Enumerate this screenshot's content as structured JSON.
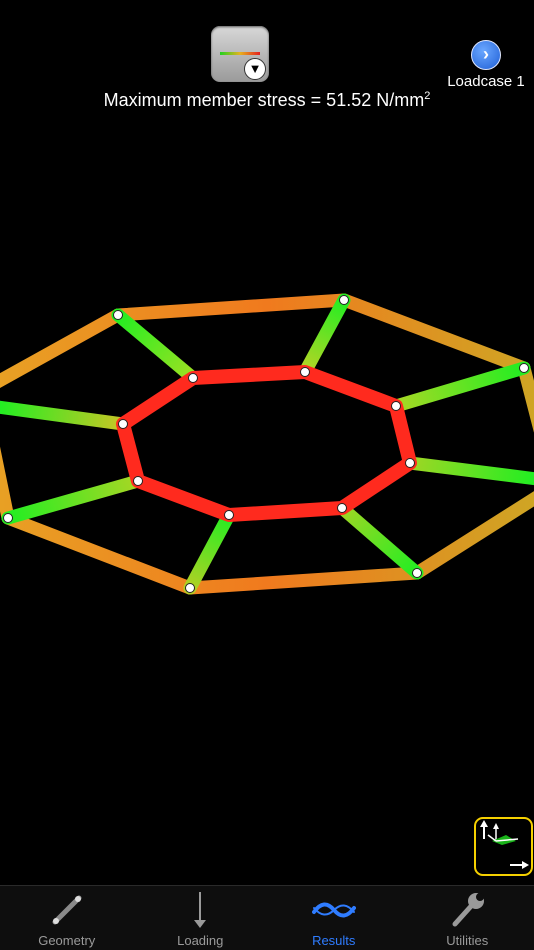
{
  "header": {
    "loadcase_label": "Loadcase 1",
    "stress_prefix": "Maximum member stress = 51.52 N/mm",
    "stress_exponent": "2"
  },
  "colors": {
    "high_stress": "#ff2a1e",
    "mid_stress": "#ee8a1f",
    "low_stress": "#21e621",
    "tab_active": "#2f7cff",
    "tab_inactive": "#9a9a9a",
    "axes_border": "#f5d000"
  },
  "tabs": [
    {
      "label": "Geometry",
      "icon": "geometry-icon"
    },
    {
      "label": "Loading",
      "icon": "loading-arrow-icon"
    },
    {
      "label": "Results",
      "icon": "results-wave-icon",
      "active": true
    },
    {
      "label": "Utilities",
      "icon": "wrench-icon"
    }
  ]
}
